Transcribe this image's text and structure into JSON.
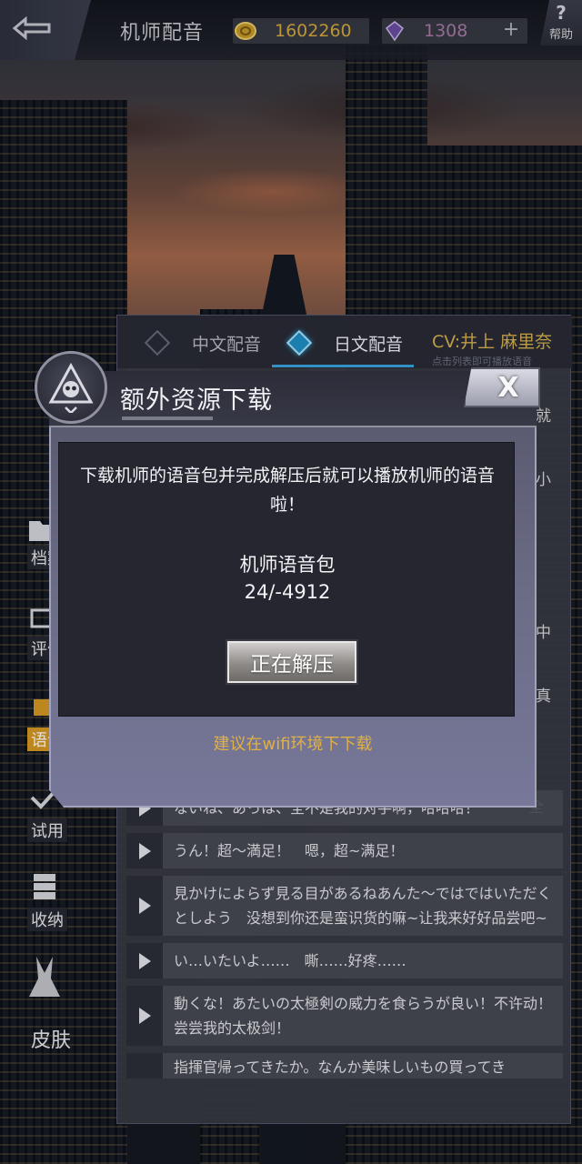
{
  "header": {
    "title": "机师配音",
    "coins": "1602260",
    "gems": "1308",
    "plus": "+",
    "help_label": "帮助",
    "help_mark": "?"
  },
  "voice_panel": {
    "tabs": [
      {
        "label": "中文配音",
        "active": false
      },
      {
        "label": "日文配音",
        "active": true
      }
    ],
    "cv": "CV:井上 麻里奈",
    "cv_sub": "点击列表即可播放语音",
    "peeks": [
      "就",
      "小",
      "中",
      "真",
      "全"
    ],
    "rows": [
      {
        "text": "ないね、あっは、全不是我的对手啊，哈哈哈！"
      },
      {
        "text": "うん！超～満足！　嗯，超~满足！"
      },
      {
        "text": "見かけによらず見る目があるねあんた～ではではいただくとしよう　没想到你还是蛮识货的嘛~让我来好好品尝吧~"
      },
      {
        "text": "い…いたいよ……　嘶……好疼……"
      },
      {
        "text": "動くな！あたいの太極剣の威力を食らうが良い！不许动！尝尝我的太极剑！"
      },
      {
        "text": "指揮官帰ってきたか。なんか美味しいもの買ってき"
      }
    ]
  },
  "side_nav": [
    {
      "label": "档案",
      "icon": "folder-icon",
      "active": false
    },
    {
      "label": "评价",
      "icon": "comment-icon",
      "active": false
    },
    {
      "label": "语音",
      "icon": "voice-icon",
      "active": true
    },
    {
      "label": "试用",
      "icon": "check-icon",
      "active": false
    },
    {
      "label": "收纳",
      "icon": "storage-icon",
      "active": false
    },
    {
      "label": "皮肤",
      "icon": "skin-icon",
      "active": false
    }
  ],
  "dialog": {
    "title": "额外资源下载",
    "close_label": "X",
    "message": "下载机师的语音包并完成解压后就可以播放机师的语音啦！",
    "pack_name": "机师语音包",
    "progress": "24/-4912",
    "action_label": "正在解压",
    "tip": "建议在wifi环境下下载"
  },
  "colors": {
    "accent_gold": "#d6a940",
    "tab_active": "#3aa6e0",
    "nav_active": "#d79a23",
    "tip": "#e0b144"
  }
}
